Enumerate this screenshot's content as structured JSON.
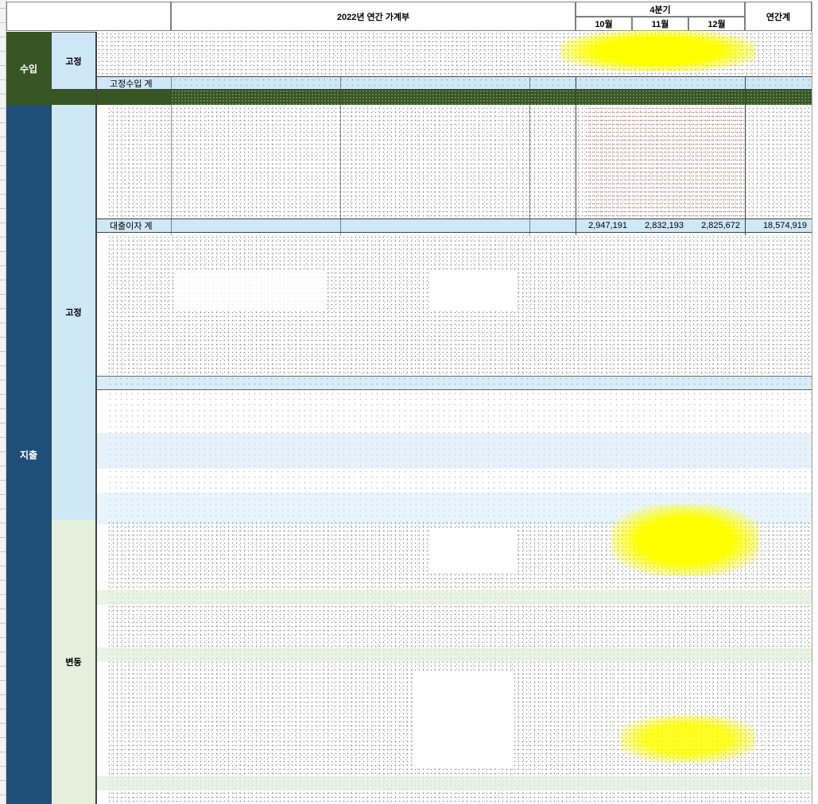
{
  "header": {
    "title": "2022년 연간 가계부",
    "quarter": "4분기",
    "months": [
      "10월",
      "11월",
      "12월"
    ],
    "annual_total": "연간계"
  },
  "categories": {
    "income": "수입",
    "expense": "지출"
  },
  "subcategories": {
    "income_fixed": "고정",
    "expense_fixed": "고정",
    "expense_variable": "변동"
  },
  "rows": {
    "fixed_income_total_label": "고정수입 계",
    "loan_interest_total": {
      "label": "대출이자 계",
      "values": [
        "2,947,191",
        "2,832,193",
        "2,825,672"
      ],
      "total": "18,574,919"
    }
  },
  "colors": {
    "income_cat": "#375623",
    "expense_cat": "#1f4e79",
    "fixed_sub_bg": "#cfe8f8",
    "variable_sub_bg": "#e4efdc",
    "highlight_yellow": "#ffff00"
  }
}
